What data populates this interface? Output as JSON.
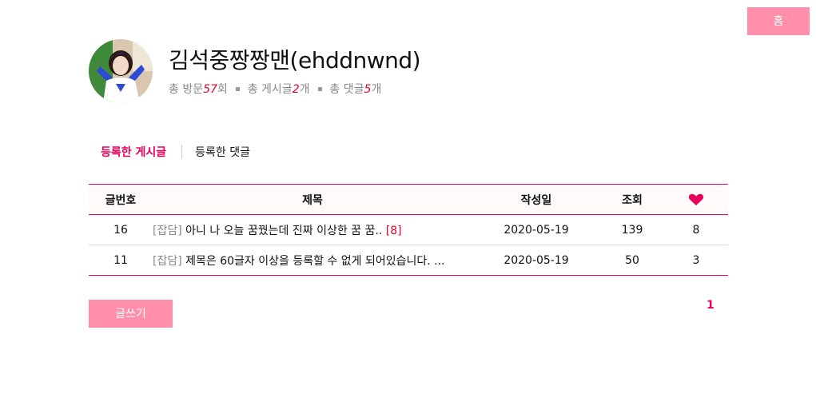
{
  "header": {
    "home_label": "홈"
  },
  "profile": {
    "name": "김석중짱짱맨(ehddnwnd)",
    "stats": {
      "visits_prefix": "총 방문",
      "visits": "57",
      "visits_suffix": "회",
      "posts_prefix": "총 게시글",
      "posts": "2",
      "posts_suffix": "개",
      "comments_prefix": "총 댓글",
      "comments": "5",
      "comments_suffix": "개"
    }
  },
  "tabs": [
    {
      "label": "등록한 게시글",
      "active": true
    },
    {
      "label": "등록한 댓글",
      "active": false
    }
  ],
  "table": {
    "headers": {
      "num": "글번호",
      "title": "제목",
      "date": "작성일",
      "views": "조회",
      "likes_icon": "heart-icon"
    },
    "rows": [
      {
        "num": "16",
        "category": "[잡담]",
        "title": "아니 나 오늘 꿈꿨는데 진짜 이상한 꿈 꿈..",
        "comments": "[8]",
        "date": "2020-05-19",
        "views": "139",
        "likes": "8"
      },
      {
        "num": "11",
        "category": "[잡담]",
        "title": "제목은 60글자 이상을 등록할 수 없게 되어있습니다. ...",
        "comments": "",
        "date": "2020-05-19",
        "views": "50",
        "likes": "3"
      }
    ]
  },
  "footer": {
    "write_label": "글쓰기",
    "page": "1"
  },
  "colors": {
    "accent": "#e8005a",
    "button": "#ff8fab",
    "count": "#e8002b"
  }
}
